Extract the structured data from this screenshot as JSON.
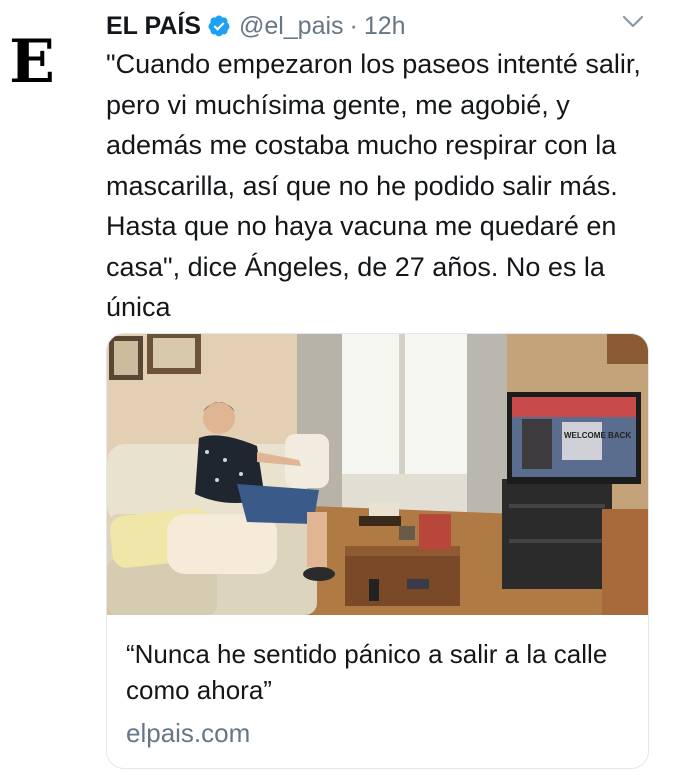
{
  "account": {
    "avatar_letter": "E",
    "name": "EL PAÍS",
    "verified": true,
    "handle": "@el_pais",
    "separator": "·",
    "time": "12h"
  },
  "tweet": {
    "text": "\"Cuando empezaron los paseos intenté salir, pero vi muchísima gente, me agobié, y además me costaba mucho respirar con la mascarilla, así que no he podido salir más. Hasta que no haya vacuna me quedaré en casa\", dice Ángeles, de 27 años. No es la única"
  },
  "card": {
    "image_alt": "Woman sitting on a sofa in a living room watching television",
    "tv_text": "WELCOME BACK",
    "title": "“Nunca he sentido pánico a salir a la calle como ahora”",
    "domain": "elpais.com"
  },
  "icons": {
    "verified": "verified-badge-icon",
    "more": "chevron-down-icon"
  },
  "colors": {
    "verified": "#1da1f2",
    "secondary_text": "#657786",
    "primary_text": "#14171a"
  }
}
